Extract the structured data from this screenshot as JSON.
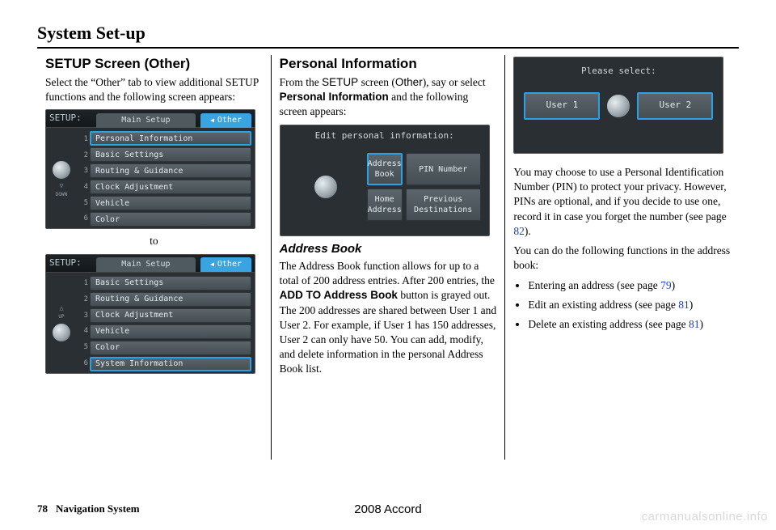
{
  "page_title": "System Set-up",
  "col1": {
    "heading": "SETUP Screen (Other)",
    "intro": "Select the “Other” tab to view additional SETUP functions and the following screen appears:",
    "to": "to",
    "shot1": {
      "setup_label": "SETUP:",
      "tab_main": "Main Setup",
      "tab_other": "Other",
      "arrow_down": "▽",
      "arrow_down_lbl": "DOWN",
      "nums": [
        "1",
        "2",
        "3",
        "4",
        "5",
        "6"
      ],
      "rows": [
        "Personal Information",
        "Basic Settings",
        "Routing & Guidance",
        "Clock Adjustment",
        "Vehicle",
        "Color"
      ],
      "hi_index": 0
    },
    "shot2": {
      "setup_label": "SETUP:",
      "tab_main": "Main Setup",
      "tab_other": "Other",
      "arrow_up": "△",
      "arrow_up_lbl": "UP",
      "nums": [
        "1",
        "2",
        "3",
        "4",
        "5",
        "6"
      ],
      "rows": [
        "Basic Settings",
        "Routing & Guidance",
        "Clock Adjustment",
        "Vehicle",
        "Color",
        "System Information"
      ],
      "hi_index": 5
    }
  },
  "col2": {
    "heading": "Personal Information",
    "intro_1": "From the ",
    "intro_setup": "SETUP",
    "intro_2": " screen (",
    "intro_other": "Other",
    "intro_3": "), say or select ",
    "intro_pib": "Personal Information",
    "intro_4": " and the following screen appears:",
    "shot": {
      "title": "Edit personal information:",
      "btns": [
        "Address Book",
        "PIN Number",
        "Home Address",
        "Previous Destinations"
      ],
      "hi_index": 0
    },
    "h3": "Address Book",
    "para_1a": "The Address Book function allows for up to a total of 200 address entries. After 200 entries, the ",
    "para_1_bold": "ADD TO Address Book",
    "para_1b": " button is grayed out. The 200 addresses are shared between User 1 and User 2. For example, if User 1 has 150 addresses, User 2 can only have 50. You can add, modify, and delete information in the personal Address Book list."
  },
  "col3": {
    "shot": {
      "title": "Please select:",
      "user1": "User 1",
      "user2": "User 2"
    },
    "para1a": "You may choose to use a Personal Identification Number (PIN) to protect your privacy. However, PINs are optional, and if you decide to use one, record it in case you forget the number (see page ",
    "para1_link": "82",
    "para1b": ").",
    "para2": "You can do the following functions in the address book:",
    "bullets": [
      {
        "pre": "Entering an address (see page ",
        "link": "79",
        "post": ")"
      },
      {
        "pre": "Edit an existing address (see page ",
        "link": "81",
        "post": ")"
      },
      {
        "pre": "Delete an existing address (see page ",
        "link": "81",
        "post": ")"
      }
    ]
  },
  "footer": {
    "page": "78",
    "section": "Navigation System",
    "model": "2008  Accord"
  },
  "watermark": "carmanualsonline.info"
}
